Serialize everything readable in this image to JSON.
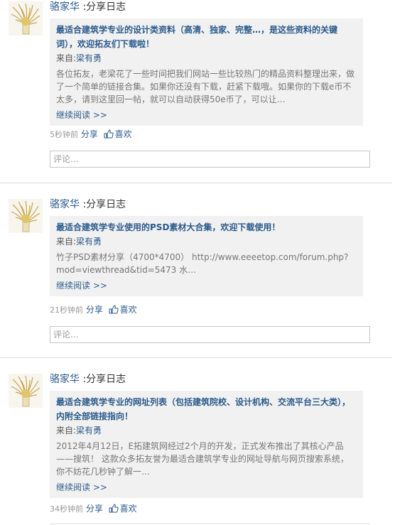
{
  "posts": [
    {
      "user": "骆家华",
      "action": " :分享日志",
      "title": "最适合建筑学专业的设计类资料（高清、独家、完整…，是这些资料的关键词），欢迎拓友们下载啦！",
      "from_label": "来自:",
      "from_user": "梁有勇",
      "summary": "各位拓友，老梁花了一些时间把我们网站一些比较热门的精品资料整理出来，做了一个简单的链接合集。如果你还没有下载，赶紧下载哦。如果你的下载e币不太多，请到这里回一帖，就可以自动获得50e币了，可以让…",
      "more": "继续阅读 >>",
      "time": "5秒钟前",
      "share": "分享",
      "like": "喜欢",
      "comment_placeholder": "评论..."
    },
    {
      "user": "骆家华",
      "action": " :分享日志",
      "title": "最适合建筑学专业使用的PSD素材大合集，欢迎下载使用！",
      "from_label": "来自:",
      "from_user": "梁有勇",
      "summary": "竹子PSD素材分享（4700*4700） http://www.eeeetop.com/forum.php?mod=viewthread&tid=5473 水…",
      "more": "继续阅读 >>",
      "time": "21秒钟前",
      "share": "分享",
      "like": "喜欢",
      "comment_placeholder": "评论..."
    },
    {
      "user": "骆家华",
      "action": " :分享日志",
      "title": "最适合建筑学专业的网址列表（包括建筑院校、设计机构、交流平台三大类），内附全部链接指向！",
      "from_label": "来自:",
      "from_user": "梁有勇",
      "summary": "2012年4月12日，E拓建筑网经过2个月的开发，正式发布推出了其核心产品——搜筑！ 这款众多拓友誉为最适合建筑学专业的网址导航与网页搜索系统，你不妨花几秒钟了解一…",
      "more": "继续阅读 >>",
      "time": "34秒钟前",
      "share": "分享",
      "like": "喜欢"
    }
  ],
  "colors": {
    "link": "#2b5a8c",
    "card_bg": "#f1f1f1",
    "muted": "#999999"
  },
  "icons": {
    "avatar": "avatar-thumbnail",
    "like": "thumbs-up-icon"
  }
}
